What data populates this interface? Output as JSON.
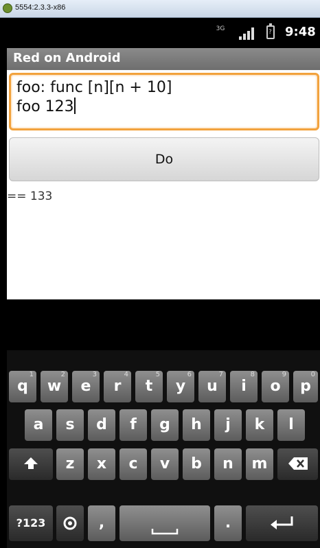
{
  "window": {
    "title": "5554:2.3.3-x86"
  },
  "status": {
    "network": "3G",
    "battery": "?",
    "time": "9:48"
  },
  "app": {
    "title": "Red on Android"
  },
  "editor": {
    "line1": "foo: func [n][n + 10]",
    "line2": "foo 123"
  },
  "button": {
    "label": "Do"
  },
  "output": {
    "text": "== 133"
  },
  "keyboard": {
    "row1": [
      {
        "k": "q",
        "h": "1"
      },
      {
        "k": "w",
        "h": "2"
      },
      {
        "k": "e",
        "h": "3"
      },
      {
        "k": "r",
        "h": "4"
      },
      {
        "k": "t",
        "h": "5"
      },
      {
        "k": "y",
        "h": "6"
      },
      {
        "k": "u",
        "h": "7"
      },
      {
        "k": "i",
        "h": "8"
      },
      {
        "k": "o",
        "h": "9"
      },
      {
        "k": "p",
        "h": "0"
      }
    ],
    "row2": [
      "a",
      "s",
      "d",
      "f",
      "g",
      "h",
      "j",
      "k",
      "l"
    ],
    "row3": [
      "z",
      "x",
      "c",
      "v",
      "b",
      "n",
      "m"
    ],
    "symbols": "?123",
    "comma": ",",
    "period": "."
  }
}
